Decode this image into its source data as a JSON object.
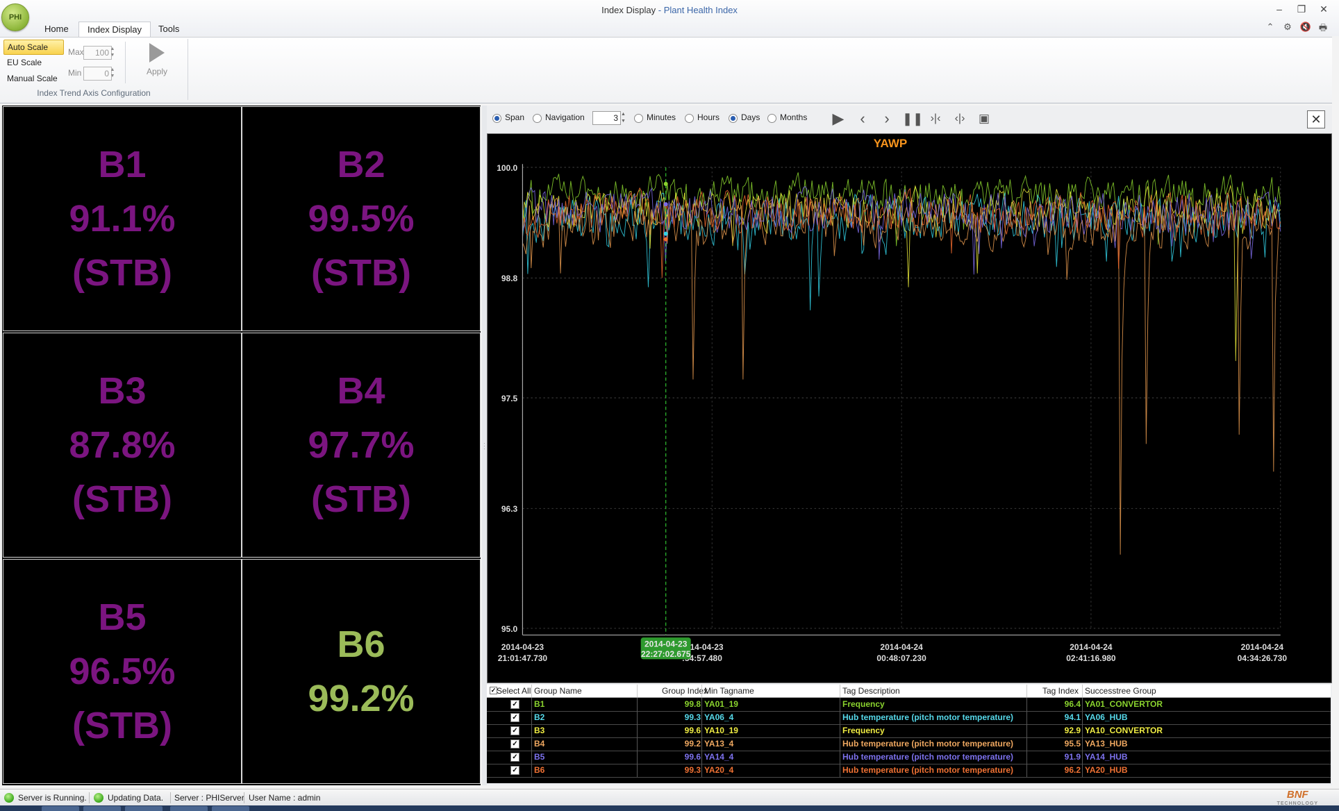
{
  "window": {
    "app_badge": "PHI",
    "title": "Index Display",
    "title_separator": " - ",
    "subtitle": "Plant Health Index",
    "controls": [
      "–",
      "❐",
      "✕"
    ]
  },
  "menu": {
    "tabs": [
      "Home",
      "Index Display",
      "Tools"
    ],
    "active_tab": "Index Display",
    "right_icons": [
      "⌃",
      "⚙",
      "🔇",
      "🖶"
    ]
  },
  "ribbon": {
    "scale_options": [
      "Auto Scale",
      "EU Scale",
      "Manual Scale"
    ],
    "active_scale": "Auto Scale",
    "max_label": "Max",
    "max_value": "100",
    "min_label": "Min",
    "min_value": "0",
    "apply_label": "Apply",
    "group_label": "Index Trend Axis Configuration"
  },
  "tiles": [
    {
      "name": "B1",
      "percent": "91.1%",
      "state": "(STB)",
      "color": "#7b1580"
    },
    {
      "name": "B2",
      "percent": "99.5%",
      "state": "(STB)",
      "color": "#7b1580"
    },
    {
      "name": "B3",
      "percent": "87.8%",
      "state": "(STB)",
      "color": "#7b1580"
    },
    {
      "name": "B4",
      "percent": "97.7%",
      "state": "(STB)",
      "color": "#7b1580"
    },
    {
      "name": "B5",
      "percent": "96.5%",
      "state": "(STB)",
      "color": "#7b1580"
    },
    {
      "name": "B6",
      "percent": "99.2%",
      "state": "",
      "color": "#9bbb59"
    }
  ],
  "chart_toolbar": {
    "span_label": "Span",
    "navigation_label": "Navigation",
    "span_value": "3",
    "units": [
      "Minutes",
      "Hours",
      "Days",
      "Months"
    ],
    "selected_unit": "Days",
    "selected_mode": "Span",
    "icons": [
      "play-icon",
      "prev-icon",
      "next-icon",
      "pause-icon",
      "zoom-in-icon",
      "zoom-out-icon",
      "camera-icon"
    ]
  },
  "chart_data": {
    "type": "line",
    "title": "YAWP",
    "title_color": "#f7941d",
    "ylim": [
      95.0,
      100.0
    ],
    "y_ticks": [
      "100.0",
      "98.8",
      "97.5",
      "96.3",
      "95.0"
    ],
    "x_ticks": [
      {
        "date": "2014-04-23",
        "time": "21:01:47.730"
      },
      {
        "date": "2014-04-23",
        "time": "22:27:02.675"
      },
      {
        "date": "2014-04-24",
        "time": "00:48:07.230"
      },
      {
        "date": "2014-04-24",
        "time": "02:41:16.980"
      },
      {
        "date": "2014-04-24",
        "time": "04:34:26.730"
      }
    ],
    "x_tick_partial": {
      "date": "2014-04-23",
      "time": ":54:57.480"
    },
    "cursor": {
      "date": "2014-04-23",
      "time": "22:27:02.675"
    },
    "grid": true,
    "series": [
      {
        "color": "#8ad32e",
        "base": 99.72,
        "spread": 0.32,
        "spikes": []
      },
      {
        "color": "#33d1e6",
        "base": 99.45,
        "spread": 0.42,
        "spikes": [
          [
            0.38,
            98.45
          ],
          [
            0.39,
            98.6
          ]
        ]
      },
      {
        "color": "#e8e83a",
        "base": 99.55,
        "spread": 0.36,
        "spikes": [
          [
            0.51,
            98.7
          ],
          [
            0.6,
            98.85
          ],
          [
            0.94,
            97.9
          ]
        ]
      },
      {
        "color": "#e89a4f",
        "base": 99.4,
        "spread": 0.45,
        "spikes": [
          [
            0.05,
            98.85
          ],
          [
            0.226,
            97.7
          ],
          [
            0.292,
            97.7
          ],
          [
            0.788,
            95.8
          ],
          [
            0.822,
            97.0
          ],
          [
            0.945,
            97.1
          ],
          [
            0.99,
            96.7
          ]
        ]
      },
      {
        "color": "#7c6be8",
        "base": 99.5,
        "spread": 0.4,
        "spikes": [
          [
            0.47,
            99.0
          ]
        ]
      },
      {
        "color": "#ee6a2e",
        "base": 99.5,
        "spread": 0.38,
        "spikes": [
          [
            0.185,
            98.8
          ],
          [
            0.786,
            98.9
          ]
        ]
      }
    ]
  },
  "grid": {
    "columns": [
      "Select All",
      "Group Name",
      "Group Index",
      "Min Tagname",
      "Tag Description",
      "Tag Index",
      "Successtree Group"
    ],
    "rows": [
      {
        "checked": "✓",
        "group": "B1",
        "index": "99.8",
        "tag": "YA01_19",
        "desc": "Frequency",
        "tag_index": "96.4",
        "tree": "YA01_CONVERTOR",
        "color": "#8ad32e"
      },
      {
        "checked": "✓",
        "group": "B2",
        "index": "99.3",
        "tag": "YA06_4",
        "desc": "Hub temperature (pitch motor temperature)",
        "tag_index": "94.1",
        "tree": "YA06_HUB",
        "color": "#56d9ea"
      },
      {
        "checked": "✓",
        "group": "B3",
        "index": "99.6",
        "tag": "YA10_19",
        "desc": "Frequency",
        "tag_index": "92.9",
        "tree": "YA10_CONVERTOR",
        "color": "#efec43"
      },
      {
        "checked": "✓",
        "group": "B4",
        "index": "99.2",
        "tag": "YA13_4",
        "desc": "Hub temperature (pitch motor temperature)",
        "tag_index": "95.5",
        "tree": "YA13_HUB",
        "color": "#eea760"
      },
      {
        "checked": "✓",
        "group": "B5",
        "index": "99.6",
        "tag": "YA14_4",
        "desc": "Hub temperature (pitch motor temperature)",
        "tag_index": "91.9",
        "tree": "YA14_HUB",
        "color": "#7d72ee"
      },
      {
        "checked": "✓",
        "group": "B6",
        "index": "99.3",
        "tag": "YA20_4",
        "desc": "Hub temperature (pitch motor temperature)",
        "tag_index": "96.2",
        "tree": "YA20_HUB",
        "color": "#ef7133"
      }
    ]
  },
  "status": {
    "server_running": "Server is Running.",
    "updating": "Updating Data.",
    "server": "Server : PHIServer",
    "user": "User Name : admin",
    "brand": "BNF",
    "brand_sub": "TECHNOLOGY"
  }
}
